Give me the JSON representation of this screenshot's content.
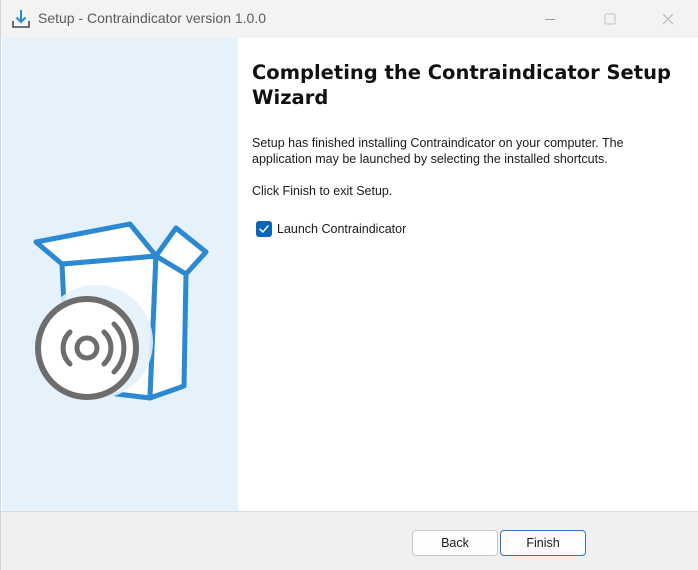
{
  "window": {
    "title": "Setup - Contraindicator version 1.0.0",
    "controls": {
      "minimize_icon": "minimize-icon",
      "maximize_icon": "maximize-icon",
      "close_icon": "close-icon"
    }
  },
  "content": {
    "heading": "Completing the Contraindicator Setup Wizard",
    "paragraph1": "Setup has finished installing Contraindicator on your computer. The application may be launched by selecting the installed shortcuts.",
    "paragraph2": "Click Finish to exit Setup.",
    "launch_checkbox": {
      "label": "Launch Contraindicator",
      "checked": true
    }
  },
  "buttons": {
    "back": "Back",
    "finish": "Finish"
  },
  "colors": {
    "accent": "#0a64b8",
    "banner_bg": "#e5f1fb",
    "box_blue": "#2b89d3",
    "disc_gray": "#6d6d6d"
  }
}
